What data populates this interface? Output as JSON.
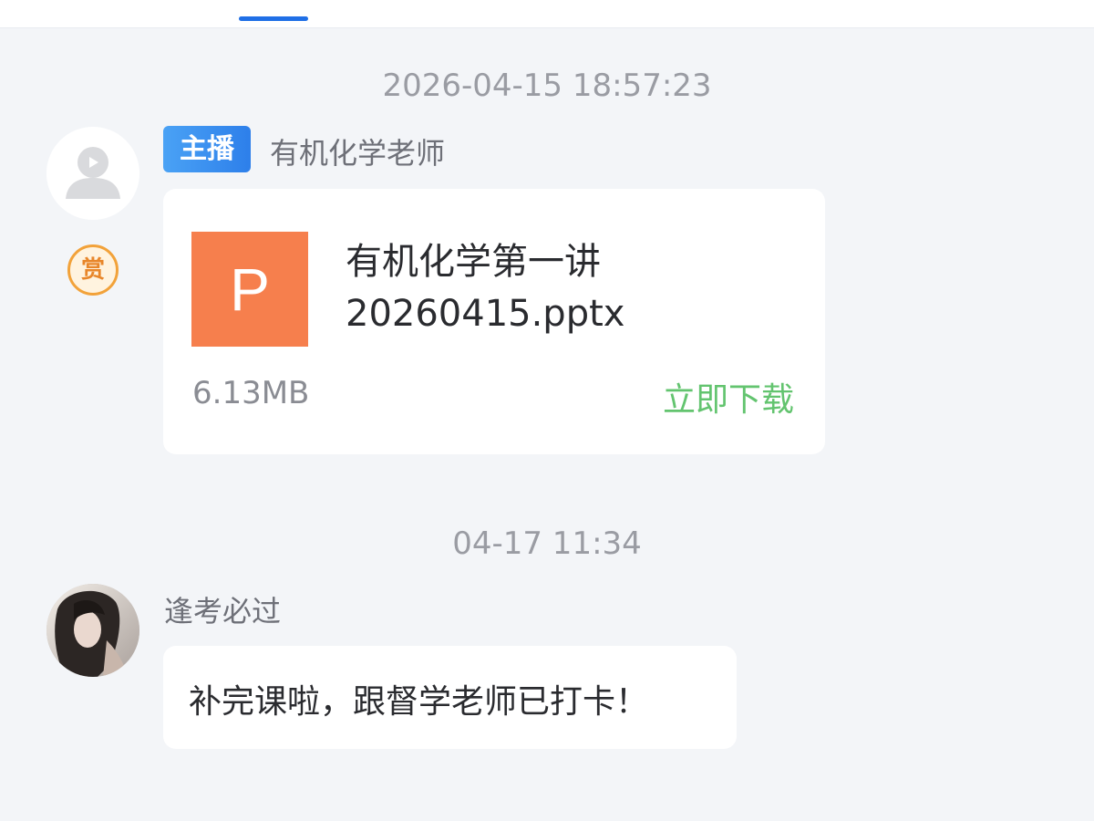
{
  "header": {
    "active_tab_indicator_color": "#1f6fe6"
  },
  "messages": [
    {
      "timestamp": "2026-04-15 18:57:23",
      "sender": {
        "role_tag": "主播",
        "name": "有机化学老师",
        "avatar_icon": "default-user-icon",
        "reward_badge": "赏"
      },
      "file": {
        "icon_letter": "P",
        "icon_color": "#f67f4d",
        "name_line1": "有机化学第一讲",
        "name_line2": "20260415.pptx",
        "size": "6.13MB",
        "action_label": "立即下载",
        "action_color": "#63c46f"
      }
    },
    {
      "timestamp": "04-17 11:34",
      "sender": {
        "name": "逢考必过",
        "avatar_icon": "user-photo-avatar"
      },
      "text": "补完课啦，跟督学老师已打卡！"
    }
  ]
}
